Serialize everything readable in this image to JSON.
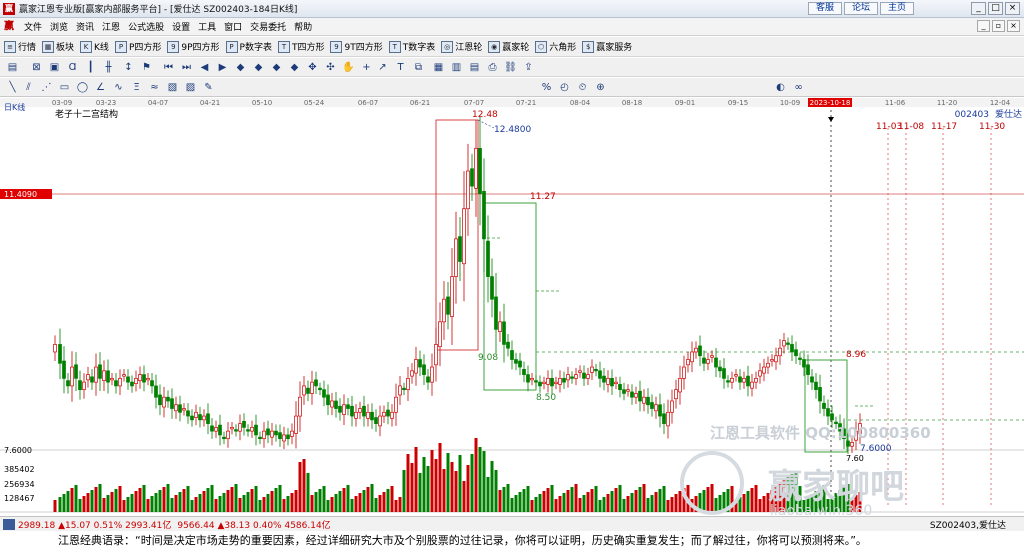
{
  "window": {
    "title": "赢家江恩专业版[赢家内部服务平台] - [爱仕达  SZ002403-184日K线]",
    "top_links": [
      "客服",
      "论坛",
      "主页"
    ]
  },
  "menu": [
    "文件",
    "浏览",
    "资讯",
    "江恩",
    "公式选股",
    "设置",
    "工具",
    "窗口",
    "交易委托",
    "帮助"
  ],
  "toolbar": [
    "行情",
    "板块",
    "K线",
    "P四方形",
    "9P四方形",
    "P数字表",
    "T四方形",
    "9T四方形",
    "T数字表",
    "江恩轮",
    "赢家轮",
    "六角形",
    "赢家服务"
  ],
  "chart": {
    "period_label": "日K线",
    "subtitle": "老子十二宫结构",
    "code": "002403",
    "name": "爱仕达",
    "date_axis": [
      "03-09",
      "03-23",
      "04-07",
      "04-21",
      "05-10",
      "05-24",
      "06-07",
      "06-21",
      "07-07",
      "07-21",
      "08-04",
      "08-18",
      "09-01",
      "09-15",
      "10-09"
    ],
    "current_date": "2023-10-18",
    "future_dates": [
      "11-06",
      "11-20",
      "12-04"
    ],
    "time_labels": [
      "11-03",
      "11-08",
      "11-17",
      "11-30"
    ],
    "price_tag": "11.4090",
    "low_tag": "7.6000",
    "high_label": "12.48",
    "high_value": "12.4800",
    "level_labels": [
      "11.27",
      "9.08",
      "8.50",
      "8.96",
      "7.60"
    ],
    "low_value": "7.6000",
    "volume_axis": [
      "385402",
      "256934",
      "128467"
    ],
    "watermark_line1": "江恩工具软件  QQ:100800360",
    "watermark_line2": "赢家聊吧",
    "watermark_line3": "liaoba.win.360",
    "colors": {
      "up": "#cc0000",
      "down": "#008000",
      "box_red": "#d43030",
      "box_green": "#2a9a2a"
    }
  },
  "status": {
    "sh": "2989.18",
    "sh_change": "▲15.07",
    "sh_pct": "0.51%",
    "sh_amount": "2993.41亿",
    "sz": "9566.44",
    "sz_change": "▲38.13",
    "sz_pct": "0.40%",
    "sz_amount": "4586.14亿",
    "right": "SZ002403,爱仕达"
  },
  "quote": "江恩经典语录：“时间是决定市场走势的重要因素，经过详细研究大市及个别股票的过往记录，你将可以证明，历史确实重复发生；而了解过往，你将可以预测将来。”。"
}
